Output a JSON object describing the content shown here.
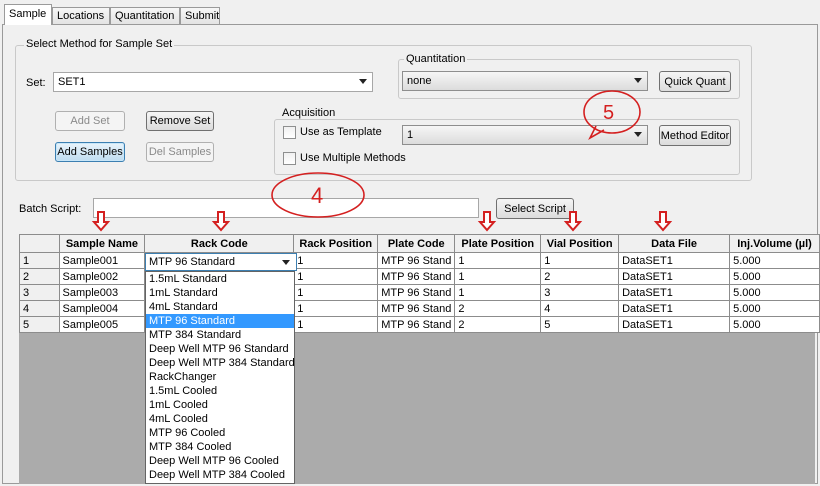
{
  "tabs": [
    "Sample",
    "Locations",
    "Quantitation",
    "Submit"
  ],
  "method_group": {
    "title": "Select Method for Sample Set",
    "set_label": "Set:",
    "set_value": "SET1",
    "add_set": "Add Set",
    "remove_set": "Remove Set",
    "add_samples": "Add Samples",
    "del_samples": "Del Samples"
  },
  "quantitation": {
    "title": "Quantitation",
    "value": "none",
    "quick_quant": "Quick Quant"
  },
  "acquisition": {
    "title": "Acquisition",
    "use_template": "Use as Template",
    "template_value": "1",
    "method_editor": "Method Editor",
    "use_multiple": "Use Multiple Methods"
  },
  "batch": {
    "label": "Batch Script:",
    "value": "",
    "select_script": "Select Script"
  },
  "annotations": {
    "four": "4",
    "five": "5"
  },
  "table": {
    "headers": [
      "",
      "Sample Name",
      "Rack Code",
      "Rack Position",
      "Plate Code",
      "Plate Position",
      "Vial Position",
      "Data File",
      "Inj.Volume (µl)"
    ],
    "rows": [
      [
        "1",
        "Sample001",
        "MTP 96 Standard",
        "1",
        "MTP 96 Stand",
        "1",
        "1",
        "DataSET1",
        "5.000"
      ],
      [
        "2",
        "Sample002",
        "",
        "1",
        "MTP 96 Stand",
        "1",
        "2",
        "DataSET1",
        "5.000"
      ],
      [
        "3",
        "Sample003",
        "",
        "1",
        "MTP 96 Stand",
        "1",
        "3",
        "DataSET1",
        "5.000"
      ],
      [
        "4",
        "Sample004",
        "",
        "1",
        "MTP 96 Stand",
        "2",
        "4",
        "DataSET1",
        "5.000"
      ],
      [
        "5",
        "Sample005",
        "",
        "1",
        "MTP 96 Stand",
        "2",
        "5",
        "DataSET1",
        "5.000"
      ]
    ]
  },
  "rack_dropdown": {
    "current": "MTP 96 Standard",
    "options": [
      "1.5mL Standard",
      "1mL Standard",
      "4mL Standard",
      "MTP 96 Standard",
      "MTP 384 Standard",
      "Deep Well MTP 96 Standard",
      "Deep Well MTP 384 Standard",
      "RackChanger",
      "1.5mL Cooled",
      "1mL Cooled",
      "4mL Cooled",
      "MTP 96 Cooled",
      "MTP 384 Cooled",
      "Deep Well MTP 96 Cooled",
      "Deep Well MTP 384 Cooled"
    ],
    "selected": "MTP 96 Standard"
  },
  "colors": {
    "annotation_red": "#d42020",
    "selection_blue": "#3399ff"
  }
}
